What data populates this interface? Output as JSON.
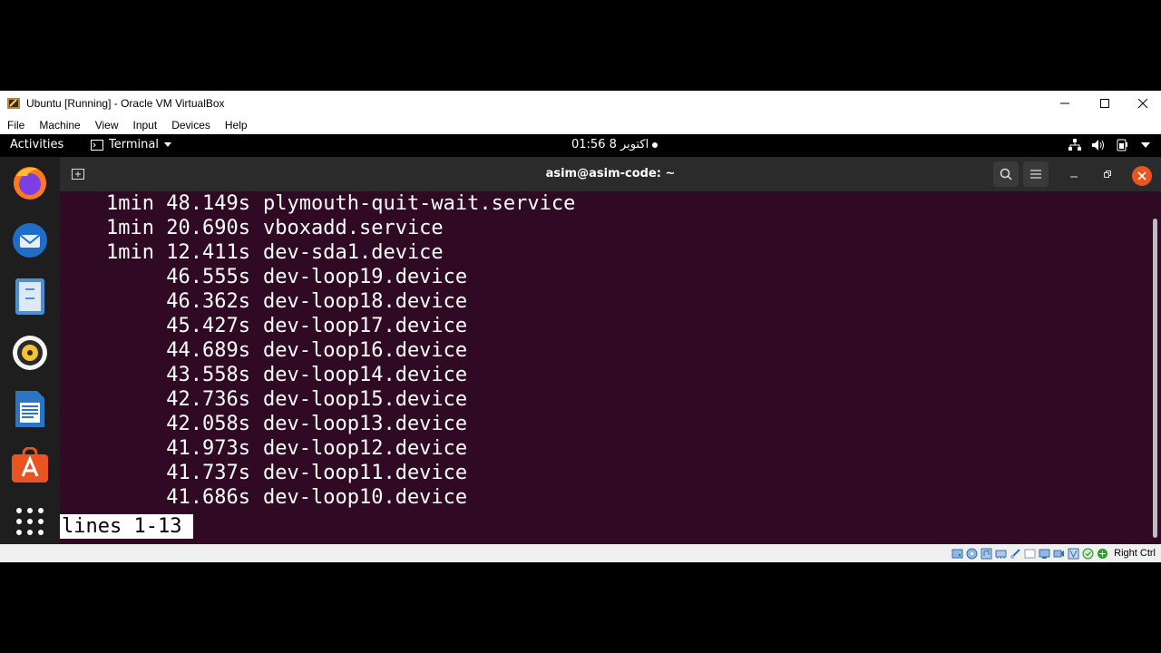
{
  "vbox": {
    "title": "Ubuntu [Running] - Oracle VM VirtualBox",
    "menu": [
      "File",
      "Machine",
      "View",
      "Input",
      "Devices",
      "Help"
    ],
    "host_key": "Right Ctrl"
  },
  "gnome": {
    "activities": "Activities",
    "app_menu": "Terminal",
    "clock": "01:56 8 اکتوبر"
  },
  "dock": [
    "firefox-icon",
    "thunderbird-icon",
    "files-icon",
    "rhythmbox-icon",
    "libreoffice-writer-icon",
    "ubuntu-software-icon",
    "show-applications-icon"
  ],
  "terminal": {
    "title": "asim@asim-code: ~",
    "lines": [
      {
        "time": "1min 48.149s",
        "unit": "plymouth-quit-wait.service"
      },
      {
        "time": "1min 20.690s",
        "unit": "vboxadd.service"
      },
      {
        "time": "1min 12.411s",
        "unit": "dev-sda1.device"
      },
      {
        "time": "46.555s",
        "unit": "dev-loop19.device"
      },
      {
        "time": "46.362s",
        "unit": "dev-loop18.device"
      },
      {
        "time": "45.427s",
        "unit": "dev-loop17.device"
      },
      {
        "time": "44.689s",
        "unit": "dev-loop16.device"
      },
      {
        "time": "43.558s",
        "unit": "dev-loop14.device"
      },
      {
        "time": "42.736s",
        "unit": "dev-loop15.device"
      },
      {
        "time": "42.058s",
        "unit": "dev-loop13.device"
      },
      {
        "time": "41.973s",
        "unit": "dev-loop12.device"
      },
      {
        "time": "41.737s",
        "unit": "dev-loop11.device"
      },
      {
        "time": "41.686s",
        "unit": "dev-loop10.device"
      }
    ],
    "status": "lines 1-13"
  },
  "colors": {
    "terminal_bg": "#300a24",
    "ubuntu_orange": "#e95420",
    "header_bg": "#2b2b2b"
  }
}
